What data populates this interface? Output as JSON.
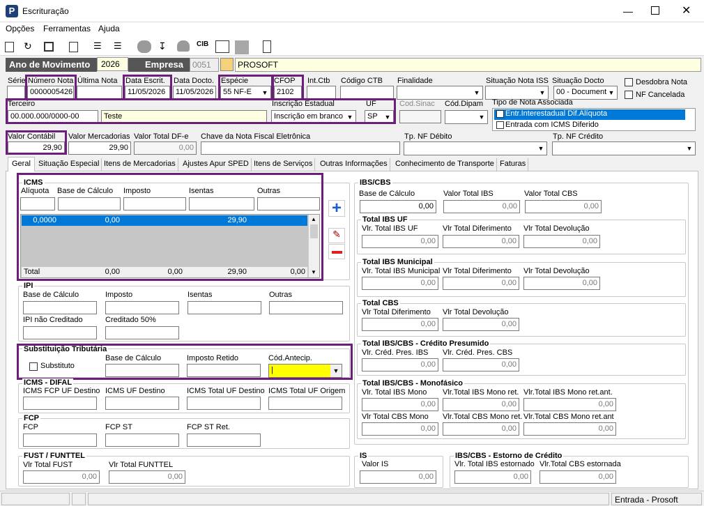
{
  "window": {
    "title": "Escrituração"
  },
  "menu": [
    "Opções",
    "Ferramentas",
    "Ajuda"
  ],
  "header": {
    "ano_label": "Ano de Movimento",
    "ano_value": "2026",
    "empresa_label": "Empresa",
    "empresa_code": "0051",
    "empresa_name": "PROSOFT"
  },
  "row1": {
    "serie_label": "Série",
    "numero_label": "Número Nota",
    "numero_value": "0000005426",
    "ultima_label": "Última Nota",
    "data_escrit_label": "Data Escrit.",
    "data_escrit_value": "11/05/2026",
    "data_docto_label": "Data Docto.",
    "data_docto_value": "11/05/2026",
    "especie_label": "Espécie",
    "especie_value": "55   NF-E",
    "cfop_label": "CFOP",
    "cfop_value": "2102",
    "intctb_label": "Int.Ctb",
    "codctb_label": "Código CTB",
    "finalidade_label": "Finalidade",
    "sit_iss_label": "Situação Nota ISS",
    "sit_docto_label": "Situação Docto",
    "sit_docto_value": "00 - Document",
    "desdobra_label": "Desdobra Nota",
    "nf_cancelada_label": "NF Cancelada"
  },
  "row2": {
    "terceiro_label": "Terceiro",
    "terceiro_cnpj": "00.000.000/0000-00",
    "terceiro_nome": "Teste",
    "ie_label": "Inscrição Estadual",
    "ie_value": "Inscrição em branco",
    "uf_label": "UF",
    "uf_value": "SP",
    "cod_sinac_label": "Cod.Sinac",
    "cod_dipam_label": "Cód.Dipam",
    "tipo_nota_label": "Tipo de Nota Associada",
    "tipo_nota_items": [
      "Entr.Interestadual Dif.Alíquota",
      "Entrada com ICMS Diferido"
    ]
  },
  "row3": {
    "valor_contabil_label": "Valor Contábil",
    "valor_contabil_value": "29,90",
    "valor_merc_label": "Valor Mercadorias",
    "valor_merc_value": "29,90",
    "valor_dfe_label": "Valor Total DF-e",
    "valor_dfe_value": "0,00",
    "chave_label": "Chave da Nota Fiscal Eletrônica",
    "tp_debito_label": "Tp. NF Débito",
    "tp_credito_label": "Tp. NF Crédito"
  },
  "tabs": [
    "Geral",
    "Situação Especial",
    "Itens de Mercadorias",
    "Ajustes Apur SPED",
    "Itens de Serviços",
    "Outras Informações",
    "Conhecimento de Transporte",
    "Faturas"
  ],
  "icms": {
    "title": "ICMS",
    "cols": [
      "Alíquota",
      "Base de Cálculo",
      "Imposto",
      "Isentas",
      "Outras"
    ],
    "row": [
      "0,0000",
      "0,00",
      "",
      "29,90",
      ""
    ],
    "total": [
      "Total",
      "0,00",
      "0,00",
      "29,90",
      "0,00"
    ]
  },
  "ipi": {
    "title": "IPI",
    "labels": [
      "Base de Cálculo",
      "Imposto",
      "Isentas",
      "Outras",
      "IPI não Creditado",
      "Creditado 50%"
    ]
  },
  "st": {
    "title": "Substituição Tributária",
    "substituto": "Substituto",
    "base": "Base de Cálculo",
    "imposto": "Imposto Retido",
    "cod": "Cód.Antecip.",
    "cod_value": "|"
  },
  "difal": {
    "title": "ICMS - DIFAL",
    "labels": [
      "ICMS FCP UF Destino",
      "ICMS UF Destino",
      "ICMS Total UF Destino",
      "ICMS Total UF Origem"
    ]
  },
  "fcp": {
    "title": "FCP",
    "labels": [
      "FCP",
      "FCP ST",
      "FCP ST Ret."
    ]
  },
  "fust": {
    "title": "FUST / FUNTTEL",
    "labels": [
      "Vlr Total FUST",
      "Vlr Total FUNTTEL"
    ],
    "values": [
      "0,00",
      "0,00"
    ]
  },
  "ibscbs": {
    "title": "IBS/CBS",
    "labels": [
      "Base de Cálculo",
      "Valor Total IBS",
      "Valor Total CBS"
    ],
    "values": [
      "0,00",
      "0,00",
      "0,00"
    ],
    "uf_title": "Total IBS UF",
    "uf_labels": [
      "Vlr. Total IBS UF",
      "Vlr Total Diferimento",
      "Vlr Total Devolução"
    ],
    "uf_values": [
      "0,00",
      "0,00",
      "0,00"
    ],
    "mun_title": "Total IBS Municipal",
    "mun_labels": [
      "Vlr. Total IBS Municipal",
      "Vlr Total Diferimento",
      "Vlr Total Devolução"
    ],
    "mun_values": [
      "0,00",
      "0,00",
      "0,00"
    ],
    "cbs_title": "Total CBS",
    "cbs_labels": [
      "Vlr Total Diferimento",
      "Vlr Total Devolução"
    ],
    "cbs_values": [
      "0,00",
      "0,00"
    ],
    "pres_title": "Total IBS/CBS - Crédito Presumido",
    "pres_labels": [
      "Vlr. Créd. Pres. IBS",
      "Vlr. Créd. Pres. CBS"
    ],
    "pres_values": [
      "0,00",
      "0,00"
    ],
    "mono_title": "Total IBS/CBS - Monofásico",
    "mono_labels": [
      "Vlr. Total IBS Mono",
      "Vlr.Total IBS Mono ret.",
      "Vlr.Total IBS Mono ret.ant.",
      "Vlr Total CBS Mono",
      "Vlr.Total CBS Mono ret.",
      "Vlr.Total CBS Mono ret.ant"
    ],
    "mono_values": [
      "0,00",
      "0,00",
      "0,00",
      "0,00",
      "0,00",
      "0,00"
    ]
  },
  "is": {
    "title": "IS",
    "label": "Valor IS",
    "value": "0,00"
  },
  "estorno": {
    "title": "IBS/CBS - Estorno de Crédito",
    "labels": [
      "Vlr. Total IBS estornado",
      "Vlr.Total CBS estornada"
    ],
    "values": [
      "0,00",
      "0,00"
    ]
  },
  "status": {
    "text": "Entrada - Prosoft"
  },
  "colors": {
    "highlight": "#6b1f7b",
    "selection": "#0078d7",
    "yellow_field": "#ffff00",
    "cream": "#ffffe1"
  }
}
